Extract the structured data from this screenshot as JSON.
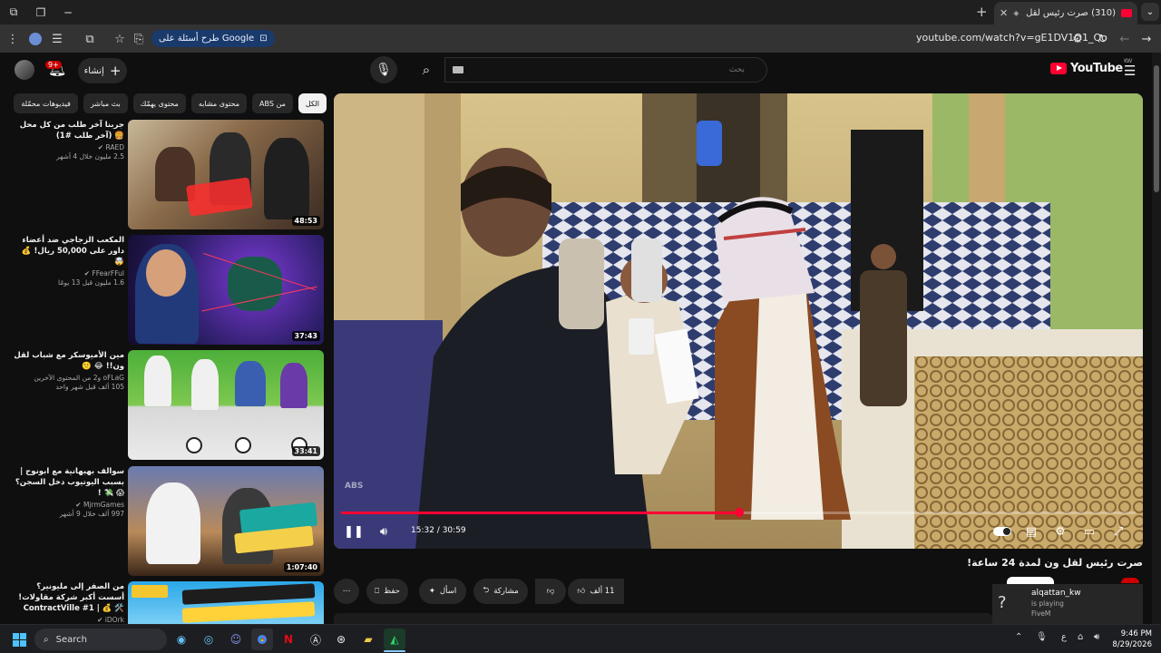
{
  "browser": {
    "tab_title": "(310) صرت رئيس لقل ون لمدة 24 ساعة!",
    "ask_google_label": "طرح أسئلة على Google",
    "url": "youtube.com/watch?v=gE1DV1Q1_Qo"
  },
  "header": {
    "create_label": "إنشاء",
    "notification_count": "9+",
    "search_placeholder": "بحث",
    "logo_text": "YouTube",
    "logo_region": "KW"
  },
  "chips": [
    {
      "label": "الكل",
      "active": true
    },
    {
      "label": "من ABS",
      "active": false
    },
    {
      "label": "محتوى مشابه",
      "active": false
    },
    {
      "label": "محتوى يهمّك",
      "active": false
    },
    {
      "label": "بث مباشر",
      "active": false
    },
    {
      "label": "فيديوهات محمّلة",
      "active": false
    }
  ],
  "recommendations": [
    {
      "title": "جربنا آخر طلب من كل محل 🍔 (آخر طلب #1)",
      "channel": "RAED ✔",
      "stats": "2.5 مليون  خلال 4 أشهر",
      "duration": "48:53"
    },
    {
      "title": "المكعب الزجاجي ضد أعضاء داور على 50,000 ريال! 💰 🤯",
      "channel": "FFearFFul ✔",
      "stats": "1.6 مليون  قبل 13 يومًا",
      "duration": "37:43"
    },
    {
      "title": "مين الأميوسكر مع شباب لقل ون!! 😂 🙂",
      "channel": "oFLaG و2 من المحتوى الآخرين",
      "stats": "105 ألف  قبل شهر واحد",
      "duration": "33:41"
    },
    {
      "title": "سوالف بهبهانية مع ابونوح | بسبب اليوتيوب دخل السجن؟ 😱 💸 !",
      "channel": "MjrmGames ✔",
      "stats": "997 ألف  خلال 9 أشهر",
      "duration": "1:07:40"
    },
    {
      "title": "من الصفر إلى مليونير؟ أسست أكبر شركة مقاولات! 🛠️ 💰 | ContractVille #1",
      "channel": "iDOrk ✔",
      "stats": "",
      "duration": ""
    }
  ],
  "player": {
    "current_time": "15:32",
    "duration": "30:59",
    "progress": 0.5015,
    "watermark": "ABS"
  },
  "video": {
    "title": "صرت رئيس لقل ون لمدة 24 ساعة!",
    "like_count": "11 ألف",
    "share_label": "مشاركة",
    "ask_label": "اسأل",
    "save_label": "حفظ"
  },
  "notification": {
    "user": "alqattan_kw",
    "status": "is playing",
    "game": "FiveM"
  },
  "taskbar": {
    "search_label": "Search",
    "lang": "ع",
    "time": "9:46 PM",
    "date": "8/29/2026"
  },
  "colors": {
    "accent": "#ff0033",
    "background": "#0f0f0f",
    "surface": "#272727"
  }
}
